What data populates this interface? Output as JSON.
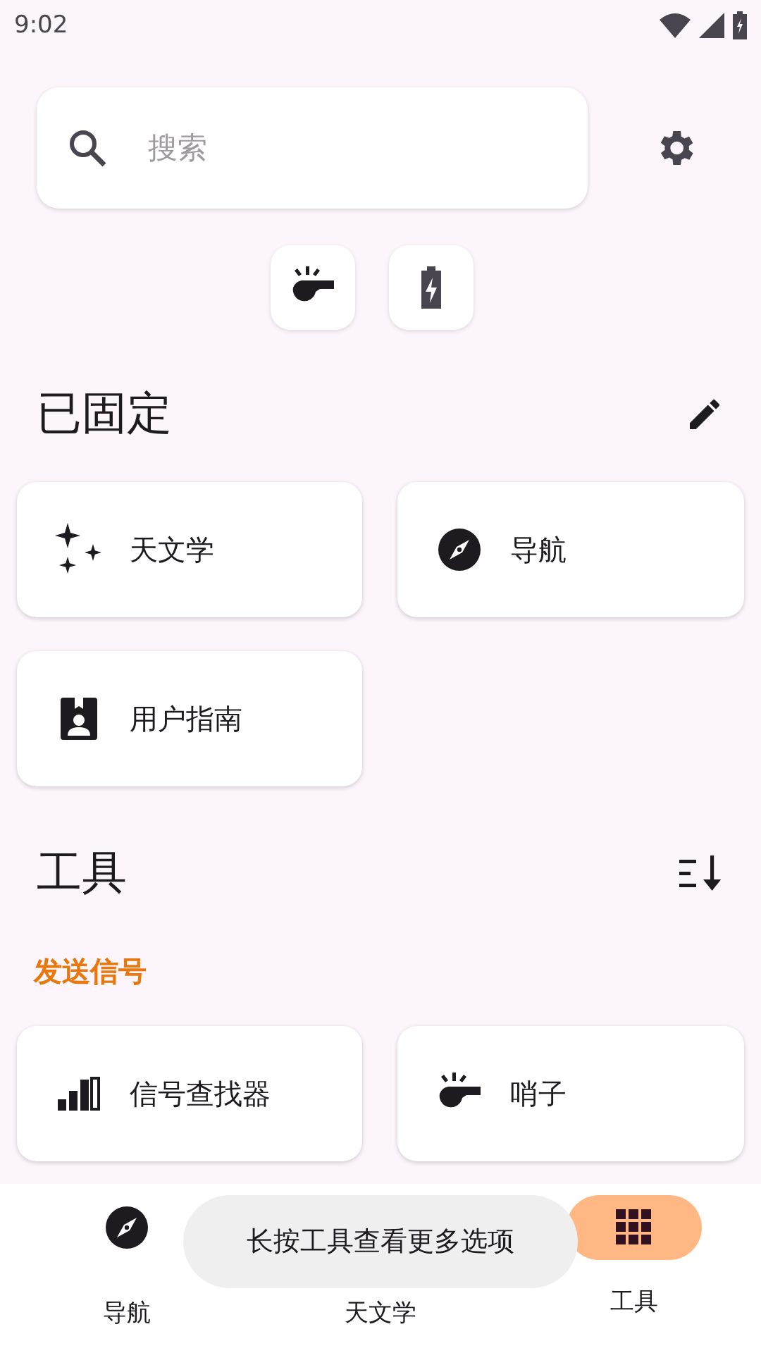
{
  "status_bar": {
    "time": "9:02"
  },
  "search": {
    "placeholder": "搜索"
  },
  "quick_actions": [
    {
      "kind": "whistle"
    },
    {
      "kind": "battery"
    }
  ],
  "pinned": {
    "title": "已固定",
    "items": [
      {
        "label": "天文学",
        "kind": "astronomy"
      },
      {
        "label": "导航",
        "kind": "navigation"
      },
      {
        "label": "用户指南",
        "kind": "guide"
      }
    ]
  },
  "tools": {
    "title": "工具",
    "groups": [
      {
        "title": "发送信号",
        "items": [
          {
            "label": "信号查找器",
            "kind": "signal"
          },
          {
            "label": "哨子",
            "kind": "whistle"
          }
        ]
      }
    ]
  },
  "bottom_nav": [
    {
      "label": "导航",
      "kind": "navigation",
      "selected": false
    },
    {
      "label": "天文学",
      "kind": "astronomy",
      "selected": false
    },
    {
      "label": "工具",
      "kind": "tools",
      "selected": true
    }
  ],
  "toast": "长按工具查看更多选项"
}
